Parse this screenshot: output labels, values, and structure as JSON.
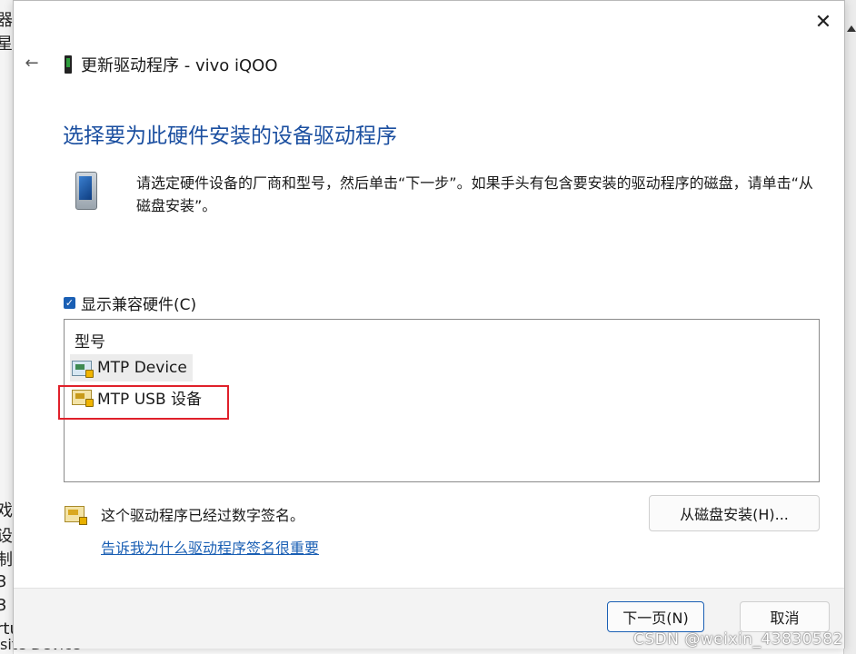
{
  "background": {
    "left_fragments": [
      "器",
      "星",
      "戏",
      "设",
      "制",
      "3",
      "3",
      "rtu"
    ],
    "bottom_text": "site Device"
  },
  "dialog": {
    "title": "更新驱动程序 - vivo iQOO",
    "heading": "选择要为此硬件安装的设备驱动程序",
    "description": "请选定硬件设备的厂商和型号，然后单击“下一步”。如果手头有包含要安装的驱动程序的磁盘，请单击“从磁盘安装”。",
    "compat_checkbox": {
      "label": "显示兼容硬件(C)",
      "checked": true
    },
    "list": {
      "header": "型号",
      "items": [
        {
          "label": "MTP Device",
          "selected": true
        },
        {
          "label": "MTP USB 设备",
          "selected": false
        }
      ]
    },
    "signature_text": "这个驱动程序已经过数字签名。",
    "signature_link": "告诉我为什么驱动程序签名很重要",
    "disk_button": "从磁盘安装(H)...",
    "next_button": "下一页(N)",
    "cancel_button": "取消"
  },
  "icons": {
    "close": "close-icon",
    "back": "back-arrow-icon",
    "device": "phone-icon",
    "driver": "driver-icon",
    "signature": "certificate-icon"
  },
  "colors": {
    "heading": "#1b4fa0",
    "link": "#1a5fb4",
    "highlight_box": "#e0202a"
  },
  "watermark": "CSDN @weixin_43830582"
}
